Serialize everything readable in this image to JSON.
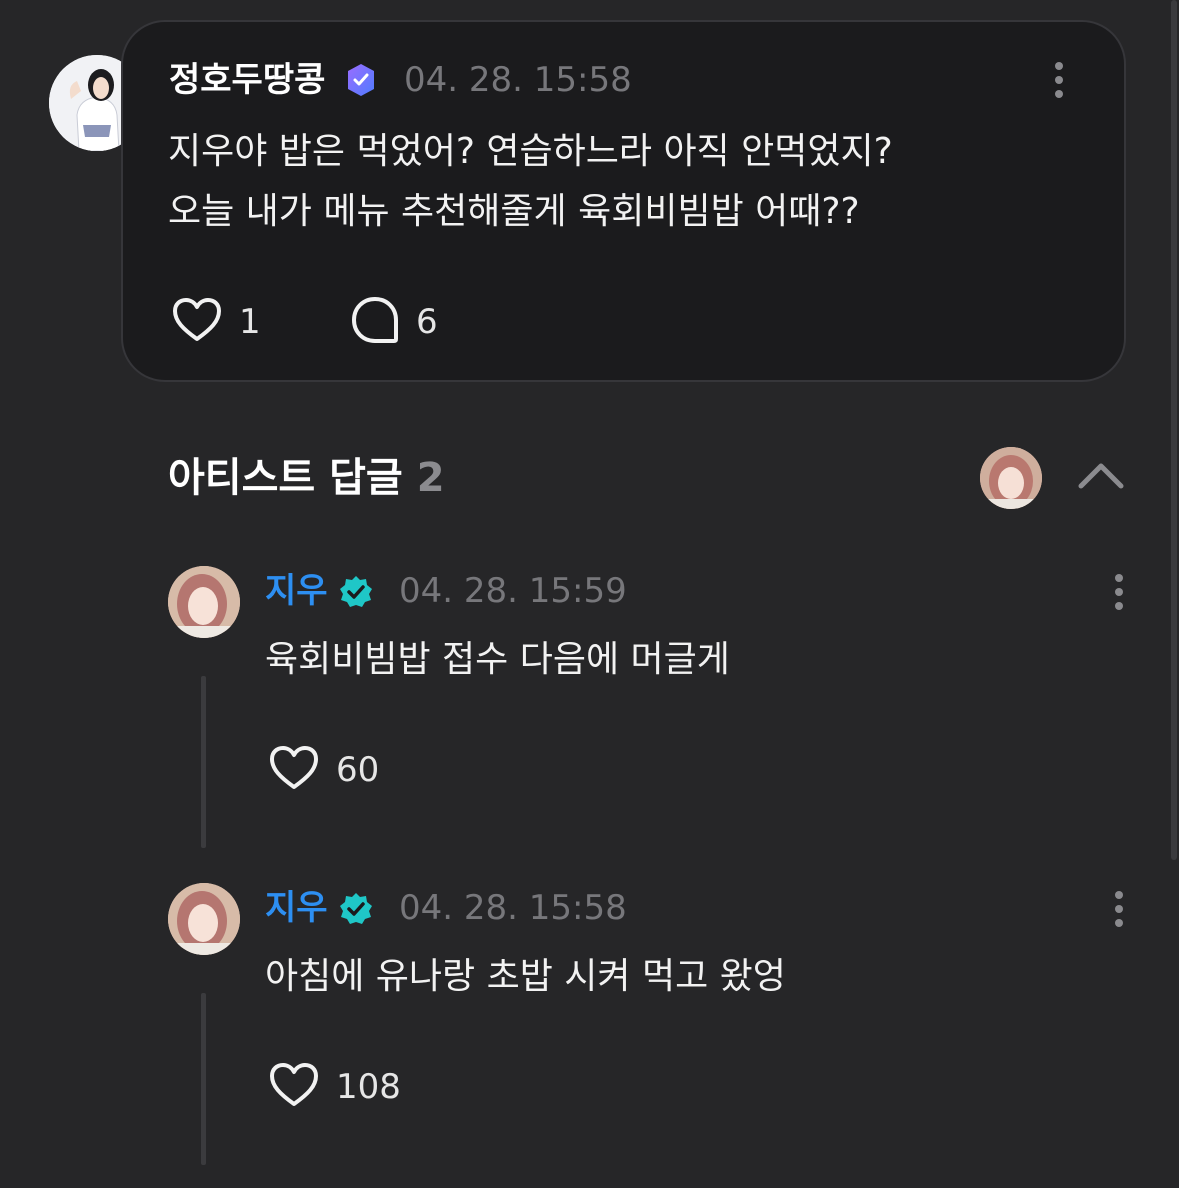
{
  "post": {
    "author": "정호두땅콩",
    "date": "04. 28. 15:58",
    "lines": [
      "지우야 밥은 먹었어? 연습하느라 아직 안먹었지?",
      "오늘 내가 메뉴 추천해줄게 육회비빔밥 어때??"
    ],
    "likes": "1",
    "comments": "6",
    "icons": {
      "verified": "weverse-verified-icon",
      "like": "heart-icon",
      "comment": "comment-icon",
      "more": "more-vertical-icon"
    }
  },
  "replies_section": {
    "title": "아티스트 답글",
    "count": "2",
    "icons": {
      "collapse": "chevron-up-icon"
    }
  },
  "replies": [
    {
      "author": "지우",
      "date": "04. 28. 15:59",
      "text": "육회비빔밥 접수 다음에 머글게",
      "likes": "60"
    },
    {
      "author": "지우",
      "date": "04. 28. 15:58",
      "text": "아침에 유나랑 초밥 시켜 먹고 왔엉",
      "likes": "108"
    }
  ],
  "colors": {
    "background": "#262628",
    "card": "#1b1b1d",
    "artist_name": "#2d8ff2",
    "verified_badge": "#1fc7c7",
    "fan_badge": "#7b5cf5",
    "muted": "#77777b"
  }
}
